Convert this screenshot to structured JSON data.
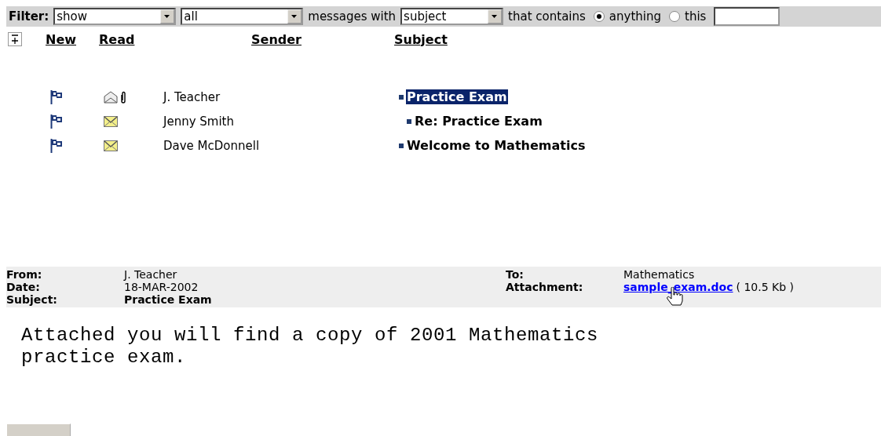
{
  "filter": {
    "parts": [
      {
        "kind": "label",
        "text": "Filter:"
      },
      {
        "kind": "select",
        "value": "show"
      },
      {
        "kind": "select",
        "value": "all"
      },
      {
        "kind": "text",
        "text": "messages with"
      },
      {
        "kind": "select",
        "value": "subject"
      },
      {
        "kind": "text",
        "text": "that contains"
      },
      {
        "kind": "radio",
        "label": "anything",
        "selected": true
      },
      {
        "kind": "radio",
        "label": "this",
        "selected": false
      },
      {
        "kind": "field"
      }
    ]
  },
  "messages": {
    "columns": [
      "New",
      "Read",
      "Sender",
      "Subject"
    ],
    "rows": [
      {
        "new": true,
        "read": true,
        "attachment": true,
        "sender": "J. Teacher",
        "subject": "Practice Exam",
        "selected": true,
        "children": [
          {
            "new": true,
            "read": false,
            "attachment": false,
            "sender": "Jenny Smith",
            "subject": "Re: Practice Exam",
            "selected": false
          }
        ]
      },
      {
        "new": true,
        "read": false,
        "attachment": false,
        "sender": "Dave McDonnell",
        "subject": "Welcome to Mathematics",
        "selected": false
      }
    ]
  },
  "preview": {
    "left": [
      {
        "label": "From:",
        "value": "J. Teacher",
        "kind": "plain"
      },
      {
        "label": "Date:",
        "value": "18-MAR-2002",
        "kind": "plain"
      },
      {
        "label": "Subject:",
        "value": "Practice Exam",
        "kind": "bold"
      }
    ],
    "right": [
      {
        "label": "To:",
        "value": "Mathematics",
        "kind": "plain"
      },
      {
        "label": "Attachment:",
        "value": "sample_exam.doc",
        "size": "( 10.5 Kb )",
        "kind": "link"
      }
    ],
    "body": "Attached you will find a copy of 2001 Mathematics\npractice exam."
  }
}
